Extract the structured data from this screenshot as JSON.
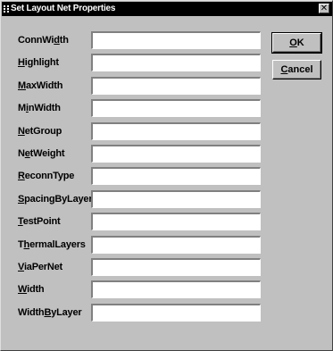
{
  "window": {
    "title": "Set Layout Net Properties",
    "close_glyph": "✕"
  },
  "fields": [
    {
      "label_before": "ConnWi",
      "label_mnemonic": "d",
      "label_after": "th",
      "value": ""
    },
    {
      "label_before": "",
      "label_mnemonic": "H",
      "label_after": "ighlight",
      "value": ""
    },
    {
      "label_before": "",
      "label_mnemonic": "M",
      "label_after": "axWidth",
      "value": ""
    },
    {
      "label_before": "M",
      "label_mnemonic": "i",
      "label_after": "nWidth",
      "value": ""
    },
    {
      "label_before": "",
      "label_mnemonic": "N",
      "label_after": "etGroup",
      "value": ""
    },
    {
      "label_before": "N",
      "label_mnemonic": "e",
      "label_after": "tWeight",
      "value": ""
    },
    {
      "label_before": "",
      "label_mnemonic": "R",
      "label_after": "econnType",
      "value": ""
    },
    {
      "label_before": "",
      "label_mnemonic": "S",
      "label_after": "pacingByLayer",
      "value": ""
    },
    {
      "label_before": "",
      "label_mnemonic": "T",
      "label_after": "estPoint",
      "value": ""
    },
    {
      "label_before": "T",
      "label_mnemonic": "h",
      "label_after": "ermalLayers",
      "value": ""
    },
    {
      "label_before": "",
      "label_mnemonic": "V",
      "label_after": "iaPerNet",
      "value": ""
    },
    {
      "label_before": "",
      "label_mnemonic": "W",
      "label_after": "idth",
      "value": ""
    },
    {
      "label_before": "Width",
      "label_mnemonic": "B",
      "label_after": "yLayer",
      "value": ""
    }
  ],
  "buttons": {
    "ok": {
      "label_mnemonic": "O",
      "label_after": "K"
    },
    "cancel": {
      "label_mnemonic": "C",
      "label_after": "ancel"
    }
  },
  "colors": {
    "dialog_background": "#c0c0c0",
    "title_bar": "#000000",
    "title_text": "#ffffff",
    "input_background": "#ffffff"
  },
  "icons": {
    "title": "window-menu-icon",
    "close": "close-icon"
  }
}
